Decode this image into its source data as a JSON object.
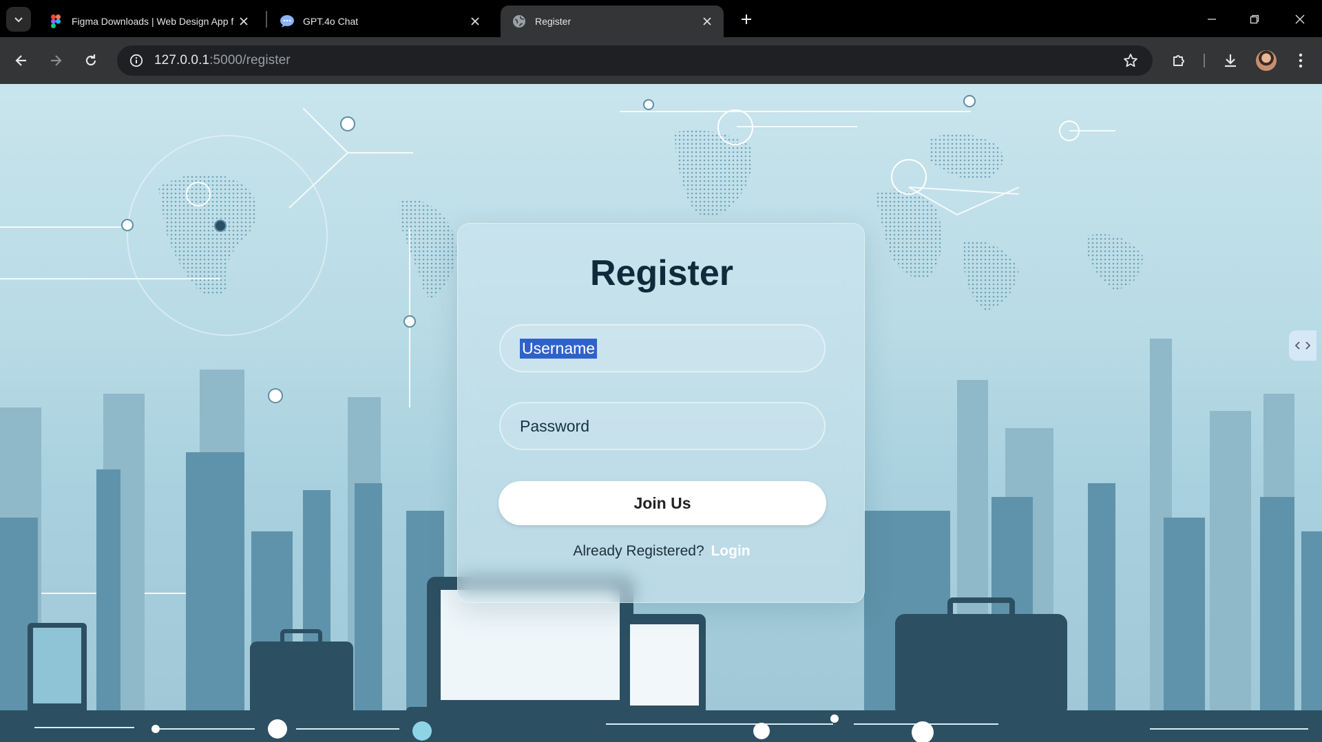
{
  "browser": {
    "tabs": [
      {
        "title": "Figma Downloads | Web Design App for D",
        "favicon": "figma-icon",
        "active": false
      },
      {
        "title": "GPT.4o Chat",
        "favicon": "chat-bubble-icon",
        "active": false
      },
      {
        "title": "Register",
        "favicon": "globe-icon",
        "active": true
      }
    ],
    "address": {
      "host": "127.0.0.1",
      "rest": ":5000/register"
    }
  },
  "page": {
    "title": "Register",
    "username_field": {
      "value": "Username"
    },
    "password_field": {
      "placeholder": "Password"
    },
    "submit_label": "Join Us",
    "already_text": "Already Registered?",
    "login_link": "Login"
  },
  "colors": {
    "accent_selection": "#2f62c9",
    "title_color": "#0f2a3a",
    "background": "#b8dbe6",
    "city_dark": "#2c4f62"
  }
}
